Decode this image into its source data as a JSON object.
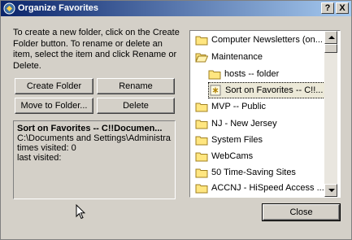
{
  "window": {
    "title": "Organize Favorites",
    "help_glyph": "?",
    "close_glyph": "X"
  },
  "instructions": "To create a new folder, click on the Create Folder button. To rename or delete an item, select the item and click Rename or Delete.",
  "buttons": {
    "create_folder": "Create Folder",
    "rename": "Rename",
    "move_to_folder": "Move to Folder...",
    "delete": "Delete",
    "close": "Close"
  },
  "info": {
    "title": "Sort on Favorites -- C!!Documen...",
    "path": "C:\\Documents and Settings\\Administra...",
    "times_visited": "times visited: 0",
    "last_visited": "last visited:"
  },
  "tree": {
    "items": [
      {
        "label": "Computer Newsletters (on...",
        "icon": "folder-icon"
      },
      {
        "label": "Maintenance",
        "icon": "open-folder-icon"
      },
      {
        "label": "hosts -- folder",
        "icon": "folder-icon"
      },
      {
        "label": "Sort on Favorites -- C!!...",
        "icon": "link-icon"
      },
      {
        "label": "MVP -- Public",
        "icon": "folder-icon"
      },
      {
        "label": "NJ - New Jersey",
        "icon": "folder-icon"
      },
      {
        "label": "System Files",
        "icon": "folder-icon"
      },
      {
        "label": "WebCams",
        "icon": "folder-icon"
      },
      {
        "label": "50 Time-Saving Sites",
        "icon": "folder-icon"
      },
      {
        "label": "ACCNJ - HiSpeed Access ...",
        "icon": "folder-icon"
      }
    ]
  }
}
